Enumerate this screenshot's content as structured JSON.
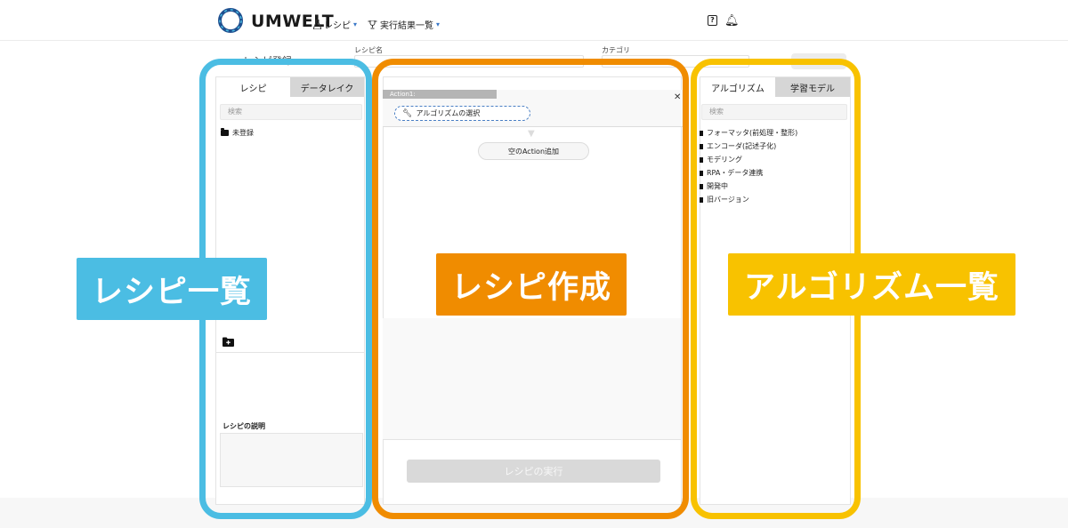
{
  "header": {
    "brand": "UMWELT",
    "nav": [
      {
        "icon": "flask-icon",
        "label": "レシピ"
      },
      {
        "icon": "trophy-icon",
        "label": "実行結果一覧"
      }
    ]
  },
  "form": {
    "page_title": "レシピ登録",
    "recipe_name_label": "レシピ名",
    "category_label": "カテゴリ"
  },
  "left_panel": {
    "tabs": [
      "レシピ",
      "データレイク"
    ],
    "search_placeholder": "検索",
    "folders": [
      "未登録"
    ],
    "description_label": "レシピの説明"
  },
  "center_panel": {
    "action_label": "Action1:",
    "algorithm_select": "アルゴリズムの選択",
    "add_empty_action": "空のAction追加",
    "run_button": "レシピの実行"
  },
  "right_panel": {
    "tabs": [
      "アルゴリズム",
      "学習モデル"
    ],
    "search_placeholder": "検索",
    "categories": [
      "フォーマッタ(前処理・整形)",
      "エンコーダ(記述子化)",
      "モデリング",
      "RPA・データ連携",
      "開発中",
      "旧バージョン"
    ]
  },
  "annotations": {
    "left": "レシピ一覧",
    "center": "レシピ作成",
    "right": "アルゴリズム一覧"
  },
  "colors": {
    "blue": "#4bbde3",
    "orange": "#f08c00",
    "yellow": "#f8c200"
  }
}
